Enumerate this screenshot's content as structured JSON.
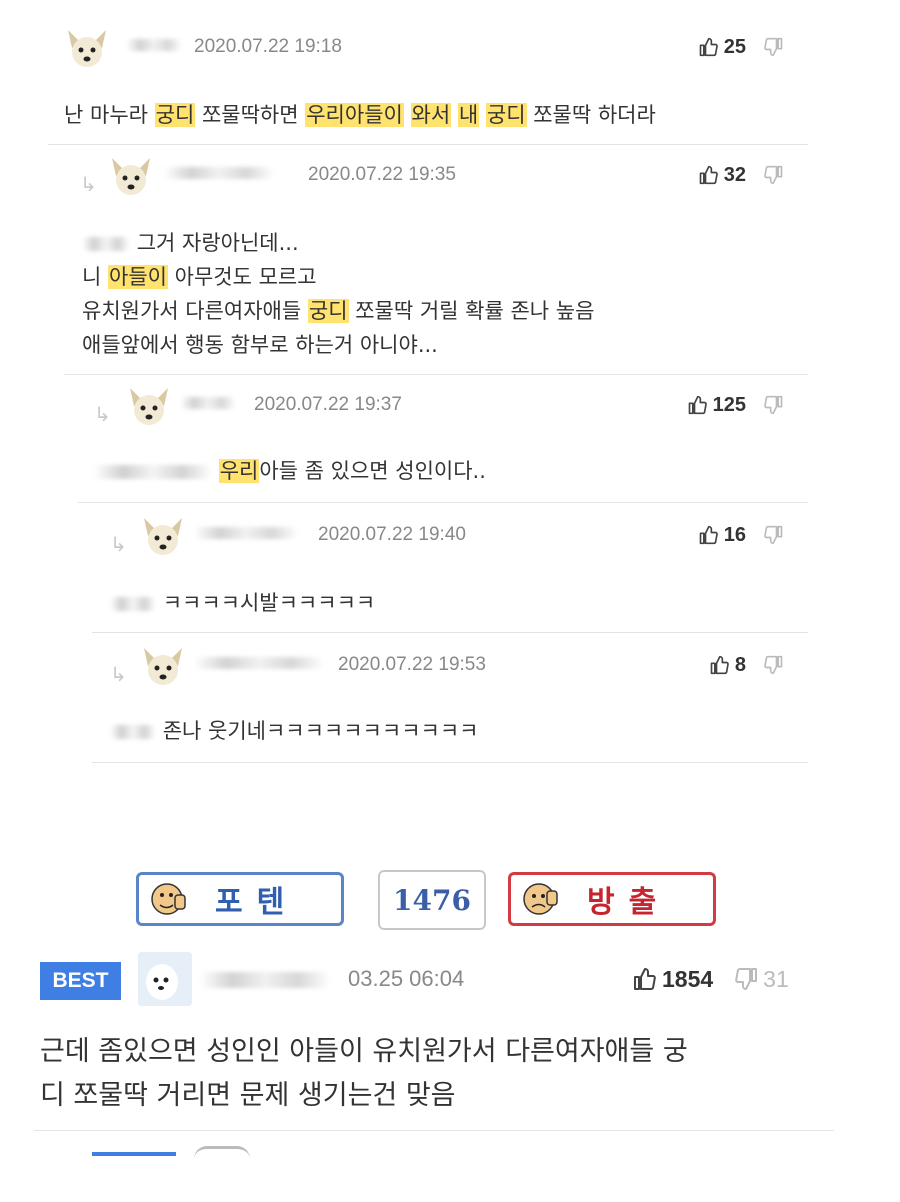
{
  "comments": [
    {
      "date": "2020.07.22 19:18",
      "likes": "25",
      "body": [
        {
          "text": "난 마누라 ",
          "hl": false
        },
        {
          "text": "궁디",
          "hl": true
        },
        {
          "text": " 쪼물딱하면 ",
          "hl": false
        },
        {
          "text": "우리아들이",
          "hl": true
        },
        {
          "text": " ",
          "hl": false
        },
        {
          "text": "와서",
          "hl": true
        },
        {
          "text": " ",
          "hl": false
        },
        {
          "text": "내",
          "hl": true
        },
        {
          "text": " ",
          "hl": false
        },
        {
          "text": "궁디",
          "hl": true
        },
        {
          "text": " 쪼물딱 하더라",
          "hl": false
        }
      ]
    },
    {
      "date": "2020.07.22 19:35",
      "likes": "32",
      "line1": "그거 자랑아닌데...",
      "line2_pre": "니 ",
      "line2_hl": "아들이",
      "line2_post": " 아무것도 모르고",
      "line3_pre": "유치원가서 다른여자애들 ",
      "line3_hl": "궁디",
      "line3_post": " 쪼물딱 거릴 확률 존나 높음",
      "line4": "애들앞에서 행동 함부로 하는거 아니야..."
    },
    {
      "date": "2020.07.22 19:37",
      "likes": "125",
      "hl": "우리",
      "post": "아들 좀 있으면 성인이다.."
    },
    {
      "date": "2020.07.22 19:40",
      "likes": "16",
      "text": "ㅋㅋㅋㅋ시발ㅋㅋㅋㅋㅋ"
    },
    {
      "date": "2020.07.22 19:53",
      "likes": "8",
      "text": "존나 웃기네ㅋㅋㅋㅋㅋㅋㅋㅋㅋㅋㅋ"
    }
  ],
  "vote": {
    "up_label": "포텐",
    "count": "1476",
    "down_label": "방출"
  },
  "best": {
    "badge": "BEST",
    "date": "03.25 06:04",
    "likes": "1854",
    "dislikes": "31",
    "line1": "근데 좀있으면 성인인 아들이 유치원가서 다른여자애들 궁",
    "line2": "디 쪼물딱 거리면 문제 생기는건 맞음"
  },
  "colors": {
    "highlight": "#ffe36e",
    "best_badge": "#3f7fe3",
    "vote_up": "#2f5fae",
    "vote_down": "#c6242e"
  }
}
